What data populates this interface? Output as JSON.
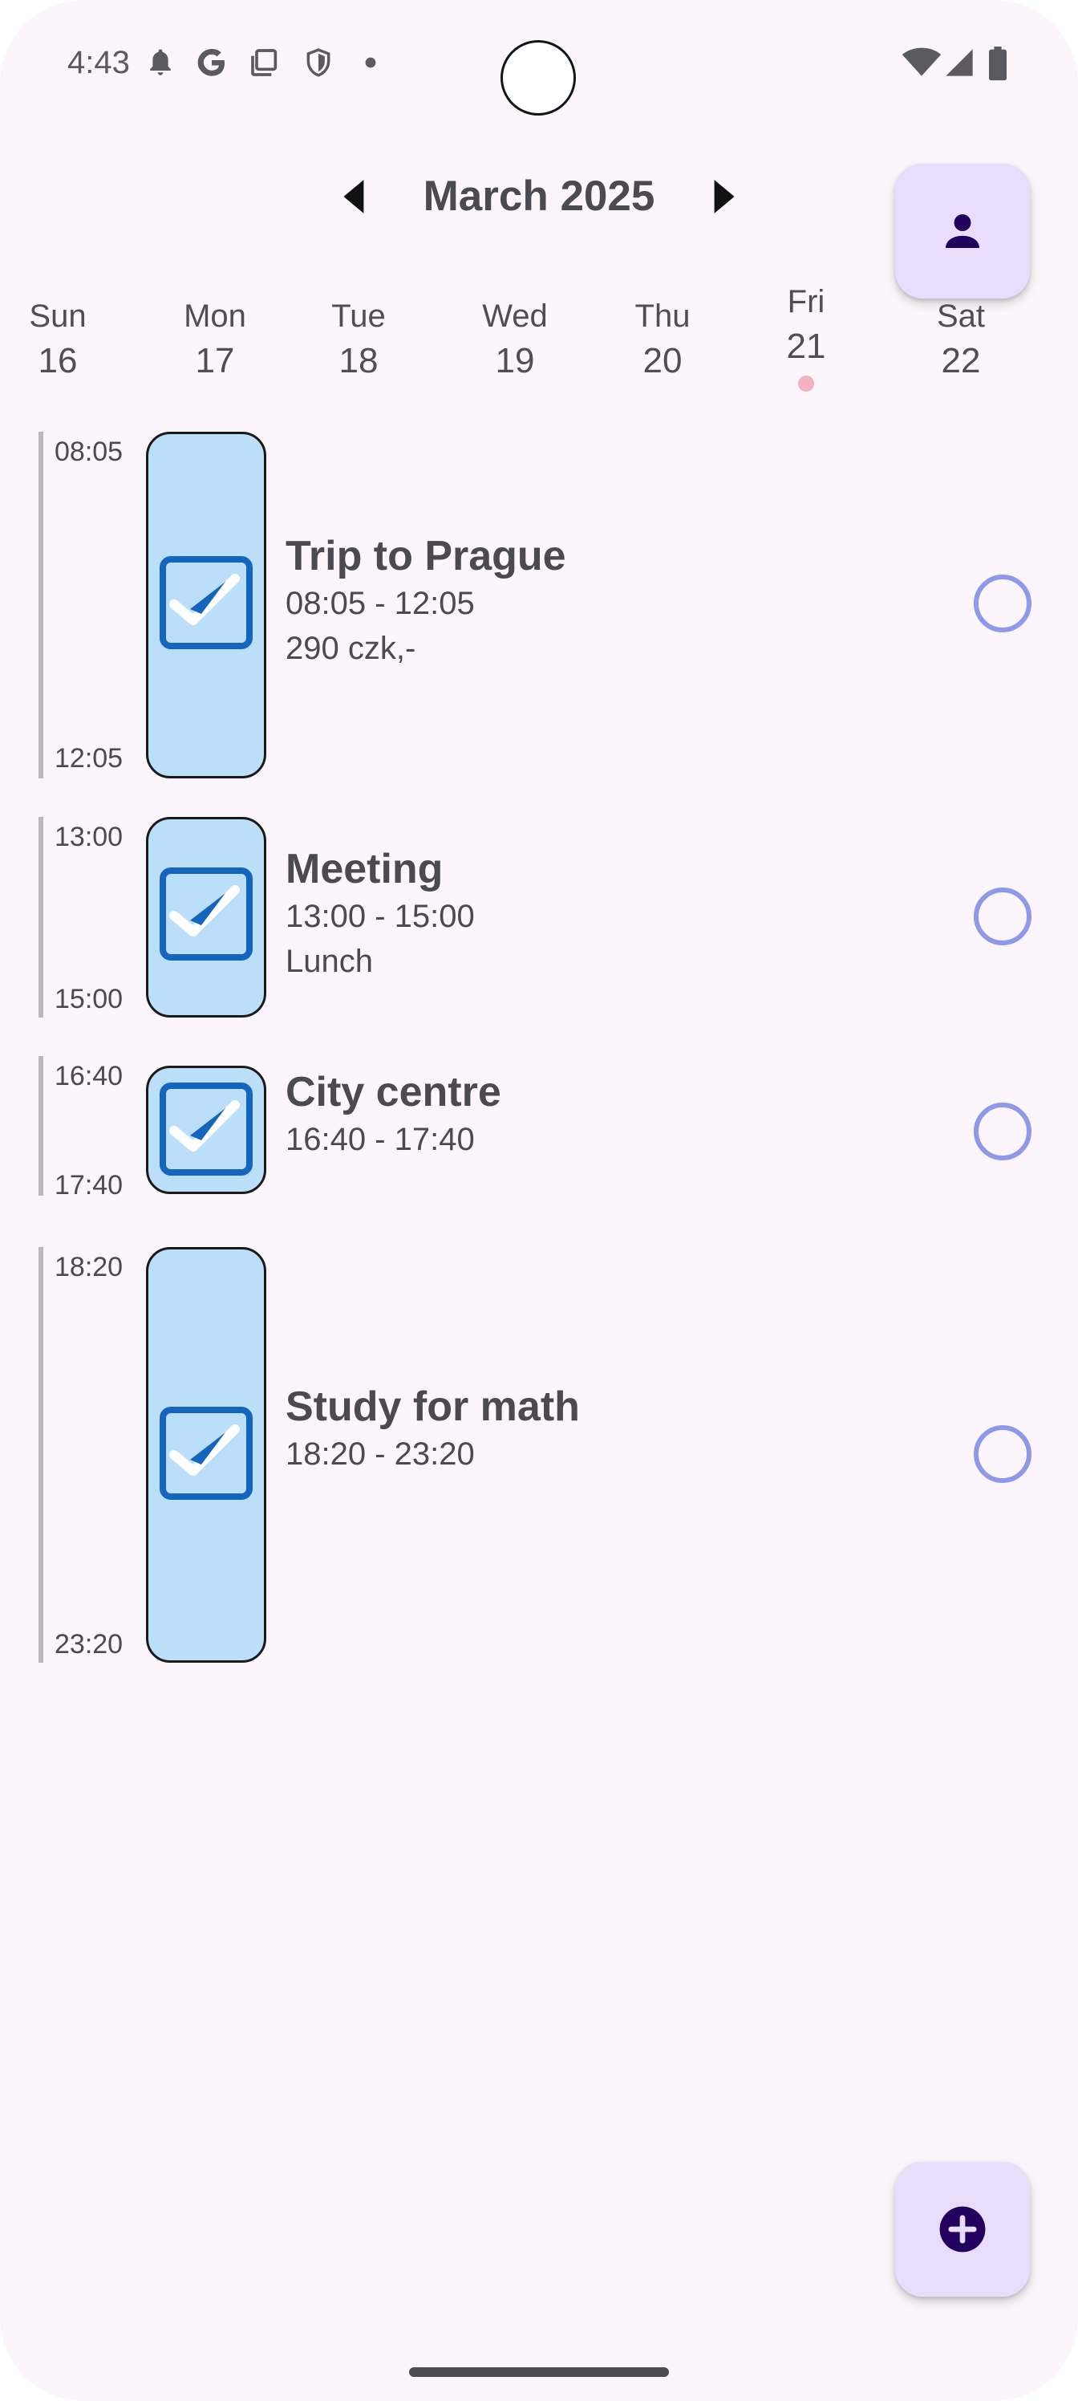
{
  "status_bar": {
    "time": "4:43",
    "left_icons": [
      "bell-icon",
      "google-icon",
      "screenshot-icon",
      "shield-icon",
      "dot-icon"
    ],
    "right_icons": [
      "wifi-icon",
      "signal-icon",
      "battery-icon"
    ]
  },
  "header": {
    "month_title": "March 2025",
    "prev_icon": "chevron-left-icon",
    "next_icon": "chevron-right-icon",
    "profile_icon": "person-icon"
  },
  "week": {
    "days": [
      {
        "name": "Sun",
        "num": "16"
      },
      {
        "name": "Mon",
        "num": "17"
      },
      {
        "name": "Tue",
        "num": "18"
      },
      {
        "name": "Wed",
        "num": "19"
      },
      {
        "name": "Thu",
        "num": "20"
      },
      {
        "name": "Fri",
        "num": "21"
      },
      {
        "name": "Sat",
        "num": "22"
      }
    ],
    "selected_day": "Fri",
    "today_marker_color": "#f3b1c1"
  },
  "events": [
    {
      "start": "08:05",
      "end": "12:05",
      "title": "Trip to Prague",
      "time_range": "08:05 - 12:05",
      "note": "290 czk,-",
      "checked": true,
      "done": false
    },
    {
      "start": "13:00",
      "end": "15:00",
      "title": "Meeting",
      "time_range": "13:00 - 15:00",
      "note": "Lunch",
      "checked": true,
      "done": false
    },
    {
      "start": "16:40",
      "end": "17:40",
      "title": "City centre",
      "time_range": "16:40 - 17:40",
      "note": "",
      "checked": true,
      "done": false
    },
    {
      "start": "18:20",
      "end": "23:20",
      "title": "Study for math",
      "time_range": "18:20 - 23:20",
      "note": "",
      "checked": true,
      "done": false
    }
  ],
  "fab": {
    "icon": "add-circle-icon"
  },
  "colors": {
    "background": "#fcf5fb",
    "event_fill": "#bbdef9",
    "check_blue": "#1565c0",
    "radio_outline": "#8e99ea",
    "fab_fill": "#eaddfb"
  }
}
